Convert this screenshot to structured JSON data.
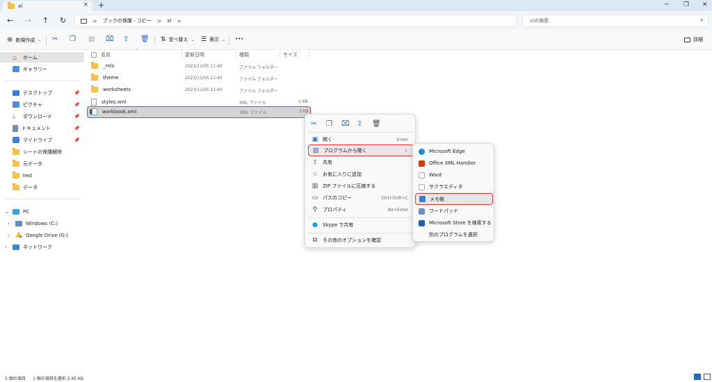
{
  "window": {
    "tab_title": "xl",
    "tab_close": "×",
    "new_tab": "+",
    "minimize": "─",
    "restore": "❐",
    "close": "✕"
  },
  "nav": {
    "back": "←",
    "forward": "→",
    "up": "↑",
    "refresh": "↻"
  },
  "address": {
    "segments": [
      "ブックの保護 - コピー",
      "xl"
    ],
    "separator": ">"
  },
  "search": {
    "placeholder": "xlの検索"
  },
  "toolbar": {
    "new_label": "新規作成",
    "sort_label": "並べ替え",
    "view_label": "表示",
    "more_label": "•••",
    "details_label": "詳細"
  },
  "sidebar": {
    "items": [
      {
        "label": "ホーム",
        "icon": "home-icon"
      },
      {
        "label": "ギャラリー",
        "icon": "gallery-icon"
      },
      {
        "label": "デスクトップ",
        "icon": "desktop-icon"
      },
      {
        "label": "ピクチャ",
        "icon": "pictures-icon"
      },
      {
        "label": "ダウンロード",
        "icon": "download-icon"
      },
      {
        "label": "ドキュメント",
        "icon": "documents-icon"
      },
      {
        "label": "マイドライブ",
        "icon": "drive-icon"
      },
      {
        "label": "シートの保護解除",
        "icon": "folder-icon"
      },
      {
        "label": "元データ",
        "icon": "folder-icon"
      },
      {
        "label": "test",
        "icon": "folder-icon"
      },
      {
        "label": "データ",
        "icon": "folder-icon"
      },
      {
        "label": "PC",
        "icon": "pc-icon"
      },
      {
        "label": "Windows (C:)",
        "icon": "windows-drive-icon"
      },
      {
        "label": "Google Drive (G:)",
        "icon": "google-drive-icon"
      },
      {
        "label": "ネットワーク",
        "icon": "network-icon"
      }
    ]
  },
  "filelist": {
    "columns": [
      "名前",
      "更新日時",
      "種類",
      "サイズ"
    ],
    "rows": [
      {
        "name": "_rels",
        "date": "2023/11/05 11:40",
        "type": "ファイル フォルダー",
        "size": ""
      },
      {
        "name": "theme",
        "date": "2023/11/05 11:40",
        "type": "ファイル フォルダー",
        "size": ""
      },
      {
        "name": "worksheets",
        "date": "2023/11/05 11:40",
        "type": "ファイル フォルダー",
        "size": ""
      },
      {
        "name": "styles.xml",
        "date": "",
        "type": "XML ファイル",
        "size": "2 KB"
      },
      {
        "name": "workbook.xml",
        "date": "",
        "type": "XML ファイル",
        "size": "3 KB"
      }
    ]
  },
  "context_menu": {
    "items": [
      {
        "label": "開く",
        "shortcut": "Enter"
      },
      {
        "label": "プログラムから開く",
        "shortcut": ""
      },
      {
        "label": "共有",
        "shortcut": ""
      },
      {
        "label": "お気に入りに追加",
        "shortcut": ""
      },
      {
        "label": "ZIP ファイルに圧縮する",
        "shortcut": ""
      },
      {
        "label": "パスのコピー",
        "shortcut": "Ctrl+Shift+C"
      },
      {
        "label": "プロパティ",
        "shortcut": "Alt+Enter"
      },
      {
        "label": "Skype で共有",
        "shortcut": ""
      },
      {
        "label": "その他のオプションを確認",
        "shortcut": ""
      }
    ],
    "submenu_arrow": "›"
  },
  "submenu": {
    "items": [
      {
        "label": "Microsoft Edge",
        "color": "#1a8fd8"
      },
      {
        "label": "Office XML Handler",
        "color": "#d83b01"
      },
      {
        "label": "Word",
        "color": "#ffffff"
      },
      {
        "label": "サクラエディタ",
        "color": "#ffffff"
      },
      {
        "label": "メモ帳",
        "color": "#3a7bd5"
      },
      {
        "label": "ワードパッド",
        "color": "#6b8fc7"
      },
      {
        "label": "Microsoft Store を検索する",
        "color": "#1f5fb0"
      },
      {
        "label": "別のプログラムを選択",
        "color": ""
      }
    ]
  },
  "status": {
    "count": "5 個の項目",
    "selection": "1 個の項目を選択  2.45 KB"
  },
  "colors": {
    "accent": "#2a66c0",
    "highlight_border": "#e03a3a",
    "folder": "#f4c24a"
  }
}
